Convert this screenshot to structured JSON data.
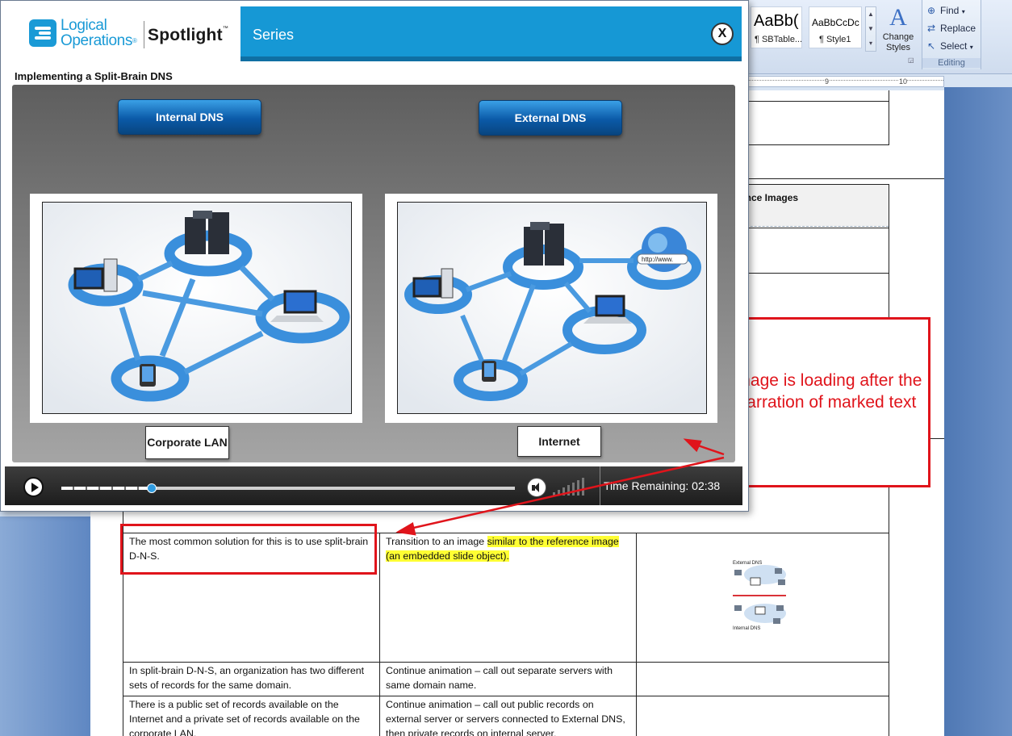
{
  "player": {
    "logo_line1": "Logical",
    "logo_line2": "Operations",
    "logo_tm": "®",
    "product": "Spotlight",
    "product_tm": "™",
    "series_label": "Series",
    "close_label": "X",
    "slide_title": "Implementing a Split-Brain DNS",
    "internal_dns_label": "Internal DNS",
    "external_dns_label": "External DNS",
    "corporate_lan_label": "Corporate LAN",
    "internet_label": "Internet",
    "www_tag": "http://www.",
    "playback_progress": 0.2,
    "time_remaining": "Time Remaining: 02:38",
    "colors": {
      "accent": "#1698d5",
      "button": "#0b5aa8",
      "controls": "#2a2a2a"
    },
    "icons": [
      "play-icon",
      "volume-icon",
      "close-icon"
    ]
  },
  "word": {
    "styles": [
      {
        "sample": "AaBb(",
        "name": "¶ SBTable..."
      },
      {
        "sample": "AaBbCcDc",
        "name": "¶ Style1"
      }
    ],
    "change_styles": "Change Styles",
    "editing": {
      "find": "Find",
      "replace": "Replace",
      "select": "Select",
      "group_label": "Editing"
    },
    "ruler": {
      "mark_9": "9",
      "mark_10": "10"
    },
    "ref_images_header": "ence Images",
    "rows": [
      {
        "narration": "The most common solution for this is to use split-brain D-N-S.",
        "direction_plain": "Transition to an image ",
        "direction_highlight": "similar to the reference image (an embedded slide object)."
      },
      {
        "narration": "In split-brain D-N-S, an organization has two different sets of records for the same domain.",
        "direction": "Continue animation – call out separate servers with same domain name."
      },
      {
        "narration": "There is a public set of records available on the Internet and a private set of records available on the corporate LAN.",
        "direction": "Continue animation – call out public records on external server or servers connected to External DNS, then private records on internal server."
      }
    ],
    "thumbnail": {
      "top_label": "External DNS",
      "bottom_label": "Internal DNS"
    }
  },
  "annotation": {
    "text": "Image is loading after the narration of marked text",
    "color": "#e0141b"
  }
}
